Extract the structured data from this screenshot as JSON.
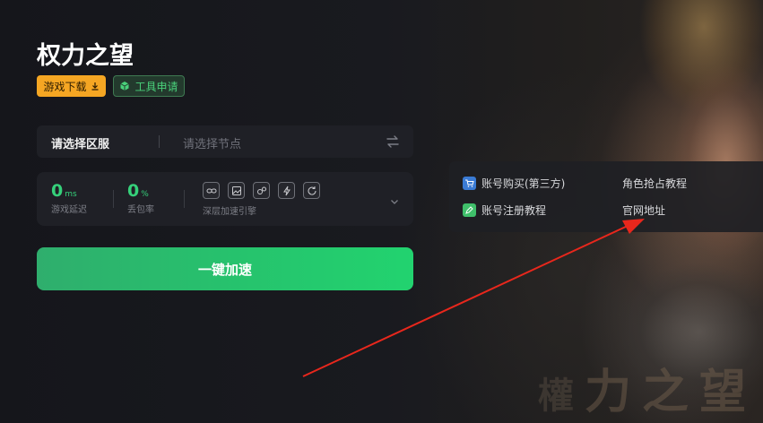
{
  "game": {
    "title": "权力之望",
    "download_label": "游戏下载",
    "tool_label": "工具申请"
  },
  "region": {
    "label": "请选择区服",
    "node_placeholder": "请选择节点"
  },
  "stats": {
    "latency_value": "0",
    "latency_unit": "ms",
    "latency_label": "游戏延迟",
    "loss_value": "0",
    "loss_unit": "%",
    "loss_label": "丢包率",
    "engine_label": "深层加速引擎",
    "engine_icons": [
      "link-icon",
      "image-icon",
      "bubbles-icon",
      "bolt-icon",
      "refresh-icon"
    ]
  },
  "accelerate_label": "一键加速",
  "links": {
    "buy_account": "账号购买(第三方)",
    "register_tutorial": "账号注册教程",
    "character_tutorial": "角色抢占教程",
    "official_site": "官网地址"
  },
  "background_title": [
    "權",
    "力之望"
  ],
  "colors": {
    "accent_green": "#26c36d",
    "download_orange": "#f5a623",
    "arrow_red": "#e8271c"
  }
}
